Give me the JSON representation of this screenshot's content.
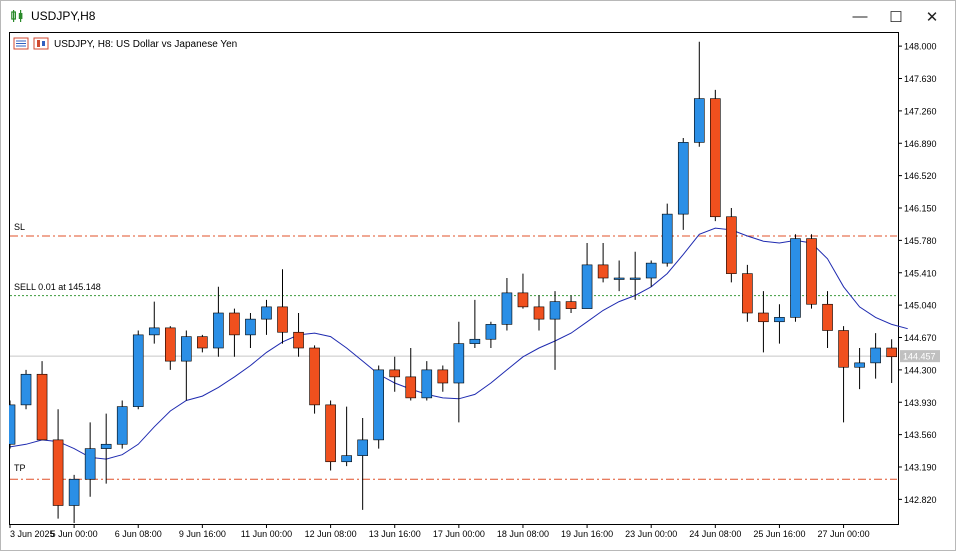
{
  "window": {
    "title": "USDJPY,H8",
    "minimize_glyph": "—",
    "maximize_glyph": "☐",
    "close_glyph": "✕"
  },
  "chart_header": {
    "symbol_text": "USDJPY, H8:  US Dollar vs Japanese Yen"
  },
  "levels": {
    "sl_label": "SL",
    "sell_label": "SELL 0.01 at 145.148",
    "tp_label": "TP",
    "current_price_label": "144.457"
  },
  "colors": {
    "bull": "#2b8fe6",
    "bear": "#f0501e",
    "ma": "#1f2bb0",
    "sl_tp_line": "#e0502a",
    "sell_line": "#3a9a3a",
    "current_price_line": "#c8c8c8",
    "axis": "#000000"
  },
  "chart_data": {
    "type": "candlestick",
    "symbol": "USDJPY",
    "timeframe": "H8",
    "ylim": [
      142.55,
      148.15
    ],
    "y_ticks": [
      "148.000",
      "147.630",
      "147.260",
      "146.890",
      "146.520",
      "146.150",
      "145.780",
      "145.410",
      "145.040",
      "144.670",
      "144.300",
      "143.930",
      "143.560",
      "143.190",
      "142.820"
    ],
    "x_ticks": [
      {
        "label": "3 Jun 2025",
        "index": 0
      },
      {
        "label": "5 Jun 00:00",
        "index": 4
      },
      {
        "label": "6 Jun 08:00",
        "index": 8
      },
      {
        "label": "9 Jun 16:00",
        "index": 12
      },
      {
        "label": "11 Jun 00:00",
        "index": 16
      },
      {
        "label": "12 Jun 08:00",
        "index": 20
      },
      {
        "label": "13 Jun 16:00",
        "index": 24
      },
      {
        "label": "17 Jun 00:00",
        "index": 28
      },
      {
        "label": "18 Jun 08:00",
        "index": 32
      },
      {
        "label": "19 Jun 16:00",
        "index": 36
      },
      {
        "label": "23 Jun 00:00",
        "index": 40
      },
      {
        "label": "24 Jun 08:00",
        "index": 44
      },
      {
        "label": "25 Jun 16:00",
        "index": 48
      },
      {
        "label": "27 Jun 00:00",
        "index": 52
      }
    ],
    "candles": [
      {
        "o": 143.45,
        "h": 143.95,
        "l": 143.4,
        "c": 143.9
      },
      {
        "o": 143.9,
        "h": 144.3,
        "l": 143.85,
        "c": 144.25
      },
      {
        "o": 144.25,
        "h": 144.4,
        "l": 143.6,
        "c": 143.5
      },
      {
        "o": 143.5,
        "h": 143.85,
        "l": 142.6,
        "c": 142.75
      },
      {
        "o": 142.75,
        "h": 143.1,
        "l": 142.55,
        "c": 143.05
      },
      {
        "o": 143.05,
        "h": 143.7,
        "l": 142.85,
        "c": 143.4
      },
      {
        "o": 143.4,
        "h": 143.8,
        "l": 143.0,
        "c": 143.45
      },
      {
        "o": 143.45,
        "h": 143.95,
        "l": 143.4,
        "c": 143.88
      },
      {
        "o": 143.88,
        "h": 144.75,
        "l": 143.85,
        "c": 144.7
      },
      {
        "o": 144.7,
        "h": 145.08,
        "l": 144.6,
        "c": 144.78
      },
      {
        "o": 144.78,
        "h": 144.8,
        "l": 144.3,
        "c": 144.4
      },
      {
        "o": 144.4,
        "h": 144.75,
        "l": 143.95,
        "c": 144.68
      },
      {
        "o": 144.68,
        "h": 144.7,
        "l": 144.5,
        "c": 144.55
      },
      {
        "o": 144.55,
        "h": 145.25,
        "l": 144.45,
        "c": 144.95
      },
      {
        "o": 144.95,
        "h": 145.0,
        "l": 144.45,
        "c": 144.7
      },
      {
        "o": 144.7,
        "h": 144.95,
        "l": 144.55,
        "c": 144.88
      },
      {
        "o": 144.88,
        "h": 145.1,
        "l": 144.7,
        "c": 145.02
      },
      {
        "o": 145.02,
        "h": 145.45,
        "l": 144.6,
        "c": 144.73
      },
      {
        "o": 144.73,
        "h": 144.95,
        "l": 144.45,
        "c": 144.55
      },
      {
        "o": 144.55,
        "h": 144.58,
        "l": 143.8,
        "c": 143.9
      },
      {
        "o": 143.9,
        "h": 143.95,
        "l": 143.15,
        "c": 143.25
      },
      {
        "o": 143.25,
        "h": 143.88,
        "l": 143.2,
        "c": 143.32
      },
      {
        "o": 143.32,
        "h": 143.75,
        "l": 142.7,
        "c": 143.5
      },
      {
        "o": 143.5,
        "h": 144.35,
        "l": 143.4,
        "c": 144.3
      },
      {
        "o": 144.3,
        "h": 144.45,
        "l": 144.05,
        "c": 144.22
      },
      {
        "o": 144.22,
        "h": 144.55,
        "l": 143.95,
        "c": 143.98
      },
      {
        "o": 143.98,
        "h": 144.4,
        "l": 143.95,
        "c": 144.3
      },
      {
        "o": 144.3,
        "h": 144.35,
        "l": 144.05,
        "c": 144.15
      },
      {
        "o": 144.15,
        "h": 144.85,
        "l": 143.7,
        "c": 144.6
      },
      {
        "o": 144.6,
        "h": 145.1,
        "l": 144.55,
        "c": 144.65
      },
      {
        "o": 144.65,
        "h": 144.85,
        "l": 144.55,
        "c": 144.82
      },
      {
        "o": 144.82,
        "h": 145.35,
        "l": 144.75,
        "c": 145.18
      },
      {
        "o": 145.18,
        "h": 145.4,
        "l": 145.0,
        "c": 145.02
      },
      {
        "o": 145.02,
        "h": 145.15,
        "l": 144.75,
        "c": 144.88
      },
      {
        "o": 144.88,
        "h": 145.2,
        "l": 144.3,
        "c": 145.08
      },
      {
        "o": 145.08,
        "h": 145.15,
        "l": 144.95,
        "c": 145.0
      },
      {
        "o": 145.0,
        "h": 145.75,
        "l": 145.0,
        "c": 145.5
      },
      {
        "o": 145.5,
        "h": 145.75,
        "l": 145.3,
        "c": 145.35
      },
      {
        "o": 145.35,
        "h": 145.55,
        "l": 145.2,
        "c": 145.35
      },
      {
        "o": 145.35,
        "h": 145.65,
        "l": 145.1,
        "c": 145.35
      },
      {
        "o": 145.35,
        "h": 145.55,
        "l": 145.25,
        "c": 145.52
      },
      {
        "o": 145.52,
        "h": 146.2,
        "l": 145.48,
        "c": 146.08
      },
      {
        "o": 146.08,
        "h": 146.95,
        "l": 145.9,
        "c": 146.9
      },
      {
        "o": 146.9,
        "h": 148.05,
        "l": 146.85,
        "c": 147.4
      },
      {
        "o": 147.4,
        "h": 147.5,
        "l": 146.0,
        "c": 146.05
      },
      {
        "o": 146.05,
        "h": 146.15,
        "l": 145.3,
        "c": 145.4
      },
      {
        "o": 145.4,
        "h": 145.5,
        "l": 144.85,
        "c": 144.95
      },
      {
        "o": 144.95,
        "h": 145.2,
        "l": 144.5,
        "c": 144.85
      },
      {
        "o": 144.85,
        "h": 145.05,
        "l": 144.6,
        "c": 144.9
      },
      {
        "o": 144.9,
        "h": 145.85,
        "l": 144.85,
        "c": 145.8
      },
      {
        "o": 145.8,
        "h": 145.85,
        "l": 145.0,
        "c": 145.05
      },
      {
        "o": 145.05,
        "h": 145.2,
        "l": 144.55,
        "c": 144.75
      },
      {
        "o": 144.75,
        "h": 144.8,
        "l": 143.7,
        "c": 144.33
      },
      {
        "o": 144.33,
        "h": 144.55,
        "l": 144.08,
        "c": 144.38
      },
      {
        "o": 144.38,
        "h": 144.72,
        "l": 144.2,
        "c": 144.55
      },
      {
        "o": 144.55,
        "h": 144.65,
        "l": 144.15,
        "c": 144.45
      },
      {
        "o": 144.46,
        "h": 144.46,
        "l": 144.45,
        "c": 144.45
      }
    ],
    "moving_average": [
      143.42,
      143.45,
      143.5,
      143.48,
      143.4,
      143.3,
      143.28,
      143.33,
      143.45,
      143.65,
      143.83,
      143.95,
      144.0,
      144.1,
      144.22,
      144.35,
      144.5,
      144.62,
      144.7,
      144.72,
      144.68,
      144.55,
      144.4,
      144.25,
      144.15,
      144.08,
      144.02,
      143.98,
      143.97,
      144.02,
      144.15,
      144.3,
      144.45,
      144.55,
      144.63,
      144.72,
      144.85,
      144.98,
      145.08,
      145.15,
      145.25,
      145.4,
      145.62,
      145.85,
      145.92,
      145.9,
      145.83,
      145.77,
      145.75,
      145.78,
      145.75,
      145.57,
      145.25,
      145.02,
      144.9,
      144.82,
      144.77
    ],
    "levels": {
      "sl": 145.83,
      "sell": 145.148,
      "tp": 143.05,
      "current": 144.457
    }
  }
}
